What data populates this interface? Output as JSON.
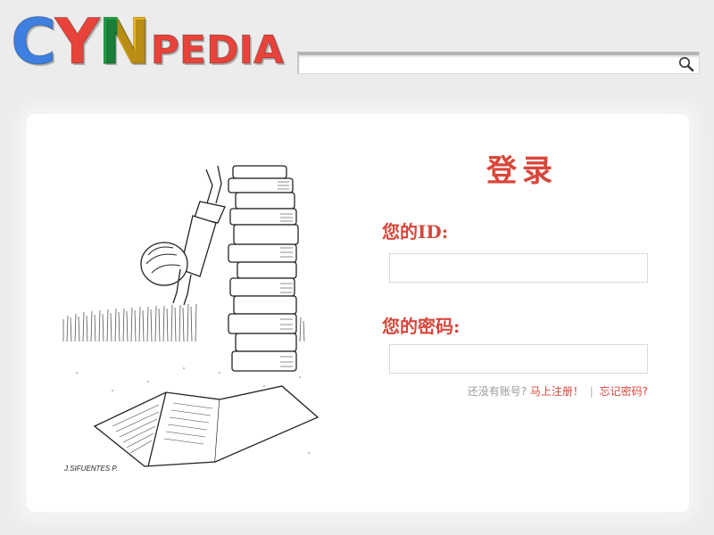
{
  "header": {
    "logo": {
      "letters": [
        {
          "char": "C",
          "color": "#3e7fe0"
        },
        {
          "char": "Y",
          "color": "#e8433a"
        },
        {
          "char": "N",
          "color": "#f6bd1a"
        },
        {
          "char": "N",
          "color": "#22a84a"
        }
      ],
      "suffix": "PEDIA",
      "suffix_color": "#e8433a"
    },
    "search": {
      "value": "",
      "placeholder": "",
      "icon": "search-icon"
    }
  },
  "login": {
    "title": "登录",
    "id_label": "您的ID:",
    "id_value": "",
    "password_label": "您的密码:",
    "password_value": "",
    "no_account_text": "还没有账号?",
    "register_link": "马上注册！",
    "separator": "|",
    "forgot_link": "忘记密码?",
    "accent_color": "#d9463b"
  },
  "illustration": {
    "signature": "J.SIFUENTES P."
  }
}
